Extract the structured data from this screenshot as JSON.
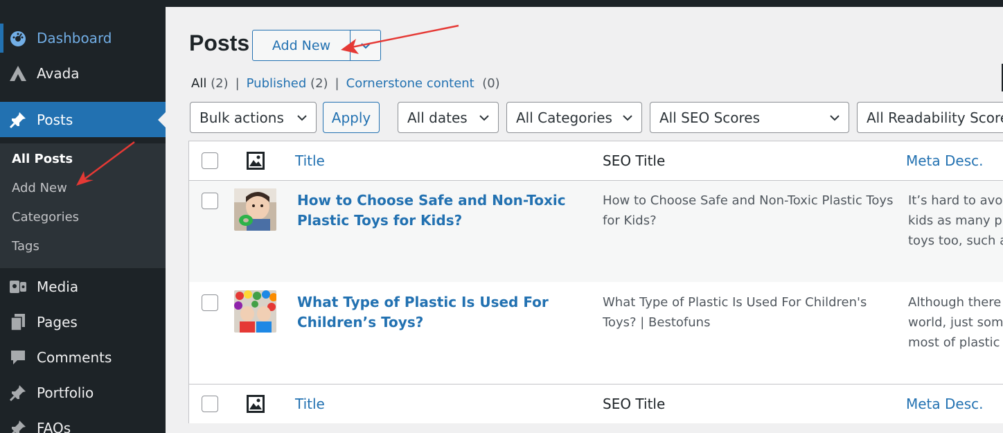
{
  "sidebar": {
    "items": [
      {
        "label": "Dashboard",
        "icon": "dashboard-icon"
      },
      {
        "label": "Avada",
        "icon": "avada-icon"
      },
      {
        "label": "Posts",
        "icon": "pin-icon"
      },
      {
        "label": "Media",
        "icon": "media-icon"
      },
      {
        "label": "Pages",
        "icon": "pages-icon"
      },
      {
        "label": "Comments",
        "icon": "comments-icon"
      },
      {
        "label": "Portfolio",
        "icon": "pin-icon"
      },
      {
        "label": "FAQs",
        "icon": "pin-icon"
      }
    ],
    "submenu": [
      "All Posts",
      "Add New",
      "Categories",
      "Tags"
    ]
  },
  "header": {
    "title": "Posts",
    "add_new_label": "Add New"
  },
  "views": {
    "all_label": "All",
    "all_count": "(2)",
    "published_label": "Published",
    "published_count": "(2)",
    "cornerstone_label": "Cornerstone content",
    "cornerstone_count": "(0)",
    "separator": "|"
  },
  "filters": {
    "bulk_actions": "Bulk actions",
    "apply_label": "Apply",
    "dates": "All dates",
    "categories": "All Categories",
    "seo_scores": "All SEO Scores",
    "readability": "All Readability Scores"
  },
  "table": {
    "columns": {
      "title": "Title",
      "seo_title": "SEO Title",
      "meta_desc": "Meta Desc."
    },
    "rows": [
      {
        "title": "How to Choose Safe and Non-Toxic Plastic Toys for Kids?",
        "seo_title": "How to Choose Safe and Non-Toxic Plastic Toys for Kids?",
        "meta_lines": [
          "It’s hard to avoid",
          "kids as many pu",
          "toys too, such as"
        ]
      },
      {
        "title": "What Type of Plastic Is Used For Children’s Toys?",
        "seo_title": "What Type of Plastic Is Used For Children's Toys? | Bestofuns",
        "meta_lines": [
          "Although there a",
          "world, just some",
          "most of plastic t"
        ]
      }
    ]
  },
  "colors": {
    "sidebar_bg": "#1d2327",
    "accent": "#2271b1",
    "annotation_arrow": "#e53935"
  }
}
